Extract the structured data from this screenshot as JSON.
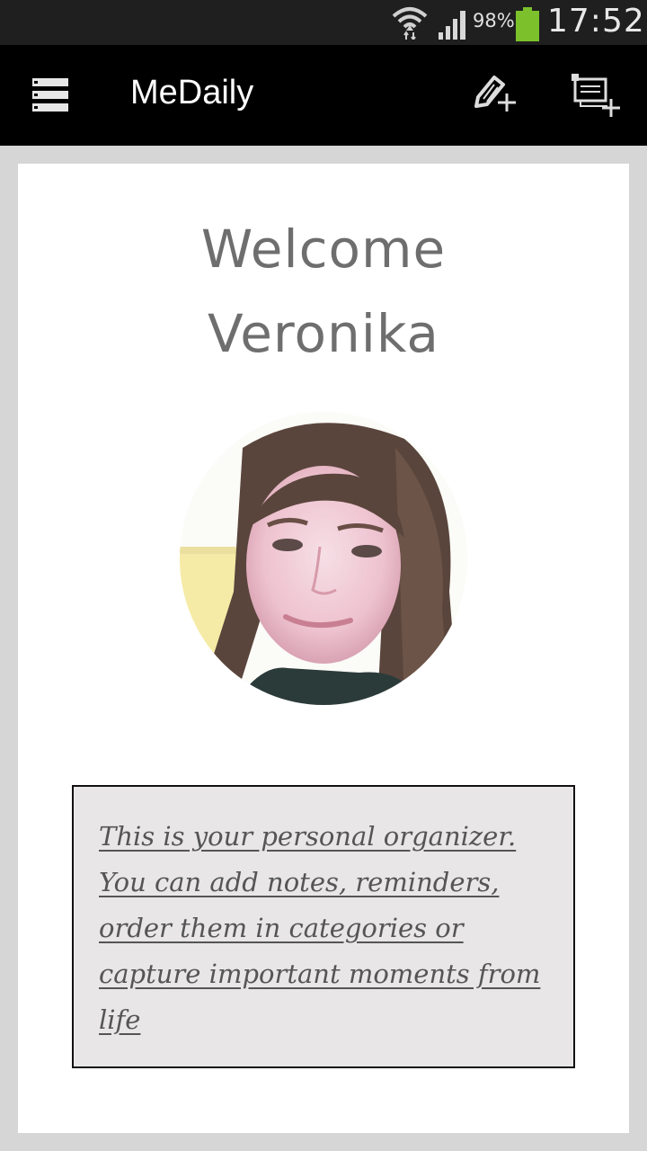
{
  "status_bar": {
    "battery_percent": "98%",
    "time": "17:52",
    "battery_color": "#7cc12b"
  },
  "app_bar": {
    "title": "MeDaily",
    "menu_icon": "hamburger-menu-icon",
    "add_note_icon": "pencil-plus-icon",
    "add_category_icon": "category-plus-icon"
  },
  "welcome": {
    "line1": "Welcome",
    "line2": "Veronika"
  },
  "intro": {
    "text": "This is your personal organizer. You can add notes, reminders, order them in categories or capture important moments from life"
  }
}
